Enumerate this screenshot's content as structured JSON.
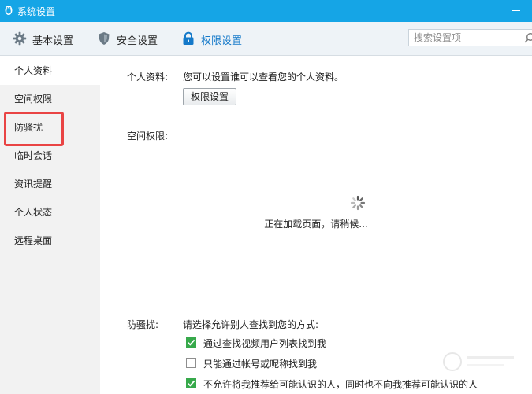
{
  "window": {
    "title": "系统设置"
  },
  "toolbar": {
    "tabs": [
      {
        "label": "基本设置",
        "icon": "gear-icon"
      },
      {
        "label": "安全设置",
        "icon": "shield-icon"
      },
      {
        "label": "权限设置",
        "icon": "lock-icon",
        "active": true
      }
    ]
  },
  "search": {
    "placeholder": "搜索设置项",
    "value": ""
  },
  "sidebar": {
    "items": [
      {
        "label": "个人资料",
        "active": true
      },
      {
        "label": "空间权限"
      },
      {
        "label": "防骚扰",
        "highlighted": true
      },
      {
        "label": "临时会话"
      },
      {
        "label": "资讯提醒"
      },
      {
        "label": "个人状态"
      },
      {
        "label": "远程桌面"
      }
    ]
  },
  "main": {
    "profile": {
      "label": "个人资料:",
      "description": "您可以设置谁可以查看您的个人资料。",
      "button": "权限设置"
    },
    "space": {
      "label": "空间权限:",
      "loading_text": "正在加载页面，请稍候..."
    },
    "anti_harassment": {
      "label": "防骚扰:",
      "description": "请选择允许别人查找到您的方式:",
      "options": [
        {
          "label": "通过查找视频用户列表找到我",
          "checked": true
        },
        {
          "label": "只能通过帐号或昵称找到我",
          "checked": false
        },
        {
          "label": "不允许将我推荐给可能认识的人，同时也不向我推荐可能认识的人",
          "checked": true
        }
      ]
    }
  },
  "colors": {
    "title_bar": "#15a5e6",
    "active_tab": "#1479c9",
    "check_green": "#37a94b",
    "highlight_red": "#e94444"
  }
}
